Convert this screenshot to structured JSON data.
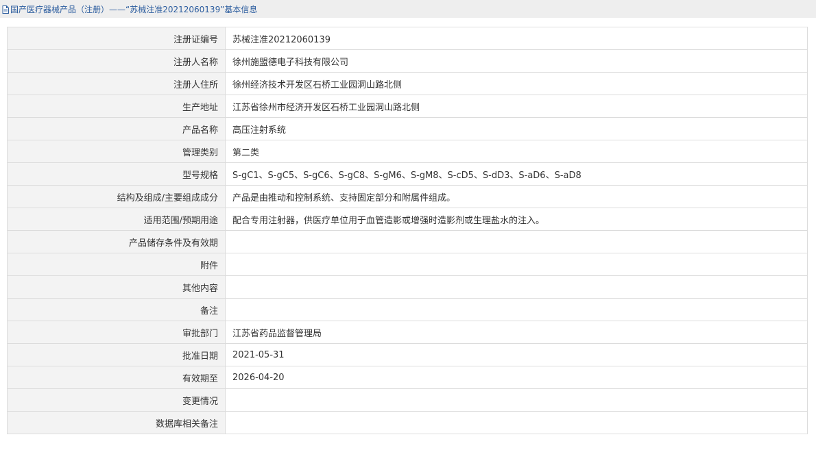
{
  "header": {
    "breadcrumb": "国产医疗器械产品（注册）——“苏械注准20212060139”基本信息",
    "icon": "document-icon"
  },
  "rows": [
    {
      "label": "注册证编号",
      "value": "苏械注准20212060139"
    },
    {
      "label": "注册人名称",
      "value": "徐州施盟德电子科技有限公司"
    },
    {
      "label": "注册人住所",
      "value": "徐州经济技术开发区石桥工业园洞山路北侧"
    },
    {
      "label": "生产地址",
      "value": "江苏省徐州市经济开发区石桥工业园洞山路北侧"
    },
    {
      "label": "产品名称",
      "value": "高压注射系统"
    },
    {
      "label": "管理类别",
      "value": "第二类"
    },
    {
      "label": "型号规格",
      "value": "S-gC1、S-gC5、S-gC6、S-gC8、S-gM6、S-gM8、S-cD5、S-dD3、S-aD6、S-aD8"
    },
    {
      "label": "结构及组成/主要组成成分",
      "value": "产品是由推动和控制系统、支持固定部分和附属件组成。"
    },
    {
      "label": "适用范围/预期用途",
      "value": "配合专用注射器，供医疗单位用于血管造影或增强时造影剂或生理盐水的注入。"
    },
    {
      "label": "产品储存条件及有效期",
      "value": ""
    },
    {
      "label": "附件",
      "value": ""
    },
    {
      "label": "其他内容",
      "value": ""
    },
    {
      "label": "备注",
      "value": ""
    },
    {
      "label": "审批部门",
      "value": "江苏省药品监督管理局"
    },
    {
      "label": "批准日期",
      "value": "2021-05-31"
    },
    {
      "label": "有效期至",
      "value": "2026-04-20"
    },
    {
      "label": "变更情况",
      "value": ""
    },
    {
      "label": "数据库相关备注",
      "value": ""
    }
  ],
  "colors": {
    "header_bg": "#eeeeee",
    "header_text": "#2b5c9e",
    "label_bg": "#f3f3f3",
    "border": "#dcdcdc",
    "text": "#333333"
  }
}
